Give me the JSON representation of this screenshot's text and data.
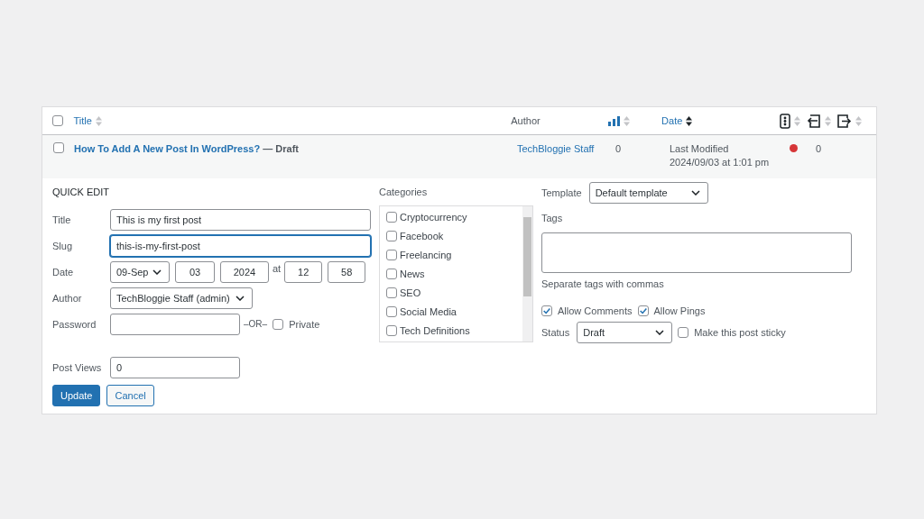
{
  "table": {
    "select_all": {
      "checked": false
    },
    "columns": [
      {
        "kind": "text",
        "label": "Title",
        "sorted": false
      },
      {
        "kind": "text",
        "label": "Author"
      },
      {
        "kind": "views",
        "sorted": false
      },
      {
        "kind": "text",
        "label": "Date",
        "sorted": true
      },
      {
        "kind": "status",
        "sorted": false
      },
      {
        "kind": "in",
        "sorted": false
      },
      {
        "kind": "out",
        "sorted": false
      }
    ],
    "row": {
      "checked": false,
      "title": "How To Add A New Post In WordPress?",
      "state": "— Draft",
      "author": "TechBloggie Staff",
      "views": "0",
      "date_label": "Last Modified",
      "date": "2024/09/03 at 1:01 pm",
      "status_dot": {
        "color": "#d63638"
      },
      "links": "0"
    }
  },
  "quick_edit": {
    "heading": "QUICK EDIT",
    "title": {
      "label": "Title",
      "value": "This is my first post"
    },
    "slug": {
      "label": "Slug",
      "value": "this-is-my-first-post",
      "focused": true
    },
    "date": {
      "label": "Date",
      "month": "09-Sep",
      "day": "03",
      "year": "2024",
      "at": "at",
      "hour": "12",
      "minute": "58"
    },
    "author": {
      "label": "Author",
      "value": "TechBloggie Staff (admin)"
    },
    "password": {
      "label": "Password",
      "or": "–OR–",
      "private_label": "Private",
      "private": false
    },
    "post_views": {
      "label": "Post Views",
      "value": "0"
    },
    "buttons": [
      {
        "label": "Update",
        "kind": "primary"
      },
      {
        "label": "Cancel",
        "kind": "secondary"
      }
    ],
    "categories": {
      "label": "Categories",
      "items": [
        {
          "label": "Cryptocurrency",
          "checked": false
        },
        {
          "label": "Facebook",
          "checked": false
        },
        {
          "label": "Freelancing",
          "checked": false
        },
        {
          "label": "News",
          "checked": false
        },
        {
          "label": "SEO",
          "checked": false
        },
        {
          "label": "Social Media",
          "checked": false
        },
        {
          "label": "Tech Definitions",
          "checked": false
        }
      ]
    },
    "template": {
      "label": "Template",
      "value": "Default template"
    },
    "tags": {
      "label": "Tags",
      "hint": "Separate tags with commas"
    },
    "allow_comments": {
      "label": "Allow Comments",
      "checked": true
    },
    "allow_pings": {
      "label": "Allow Pings",
      "checked": true
    },
    "status": {
      "label": "Status",
      "value": "Draft"
    },
    "sticky": {
      "label": "Make this post sticky",
      "checked": false
    }
  }
}
